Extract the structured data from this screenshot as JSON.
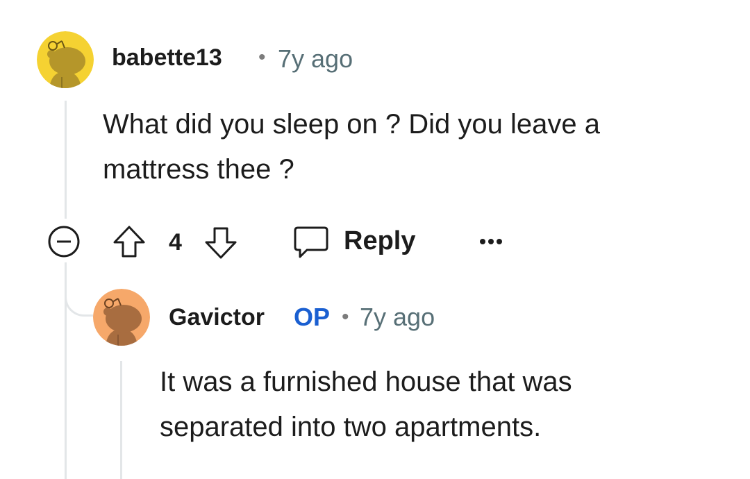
{
  "comments": [
    {
      "username": "babette13",
      "separator": "•",
      "time": "7y ago",
      "body": "What did you sleep on ? Did you leave a mattress thee ?",
      "score": "4",
      "reply_label": "Reply",
      "avatar_color": "#f5d232"
    },
    {
      "username": "Gavictor",
      "badge": "OP",
      "separator": "•",
      "time": "7y ago",
      "body": "It was a furnished house that was separated into two apartments.",
      "avatar_color": "#f6a86a"
    }
  ],
  "icons": {
    "collapse": "collapse-icon",
    "upvote": "upvote-icon",
    "downvote": "downvote-icon",
    "reply": "comment-bubble-icon",
    "more": "more-options-icon"
  },
  "colors": {
    "op_badge": "#1a5fd1",
    "thread_line": "#e3e6e8",
    "muted_text": "#576f76"
  }
}
